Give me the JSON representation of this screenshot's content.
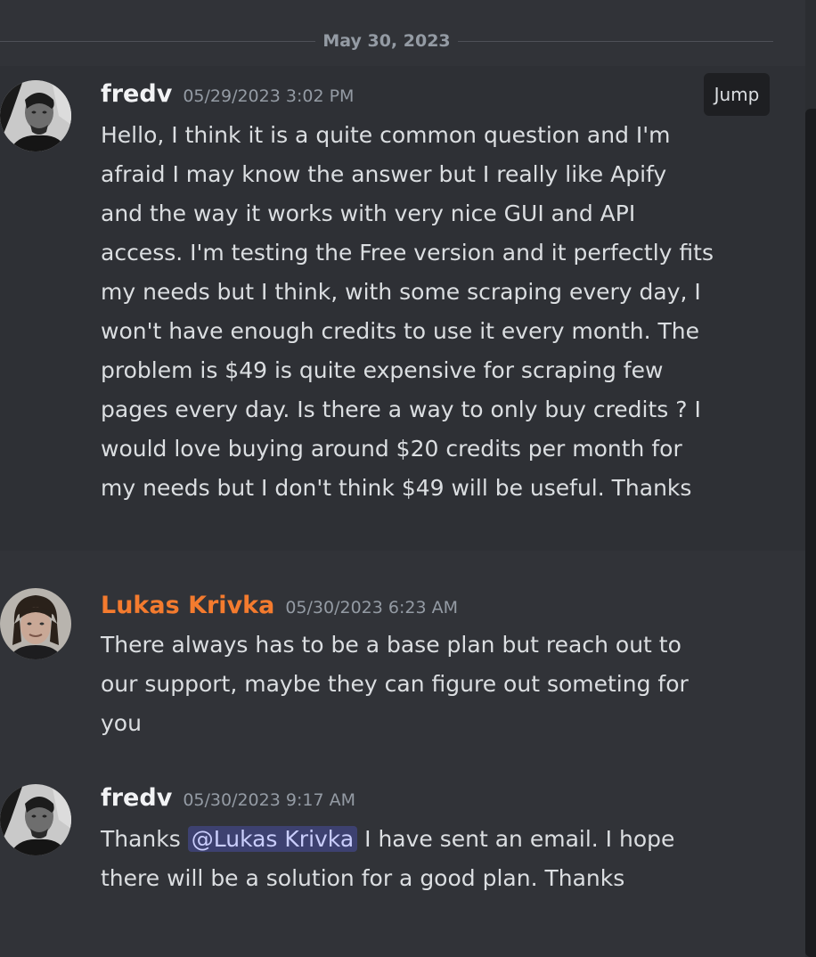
{
  "date_divider": "May 30, 2023",
  "jump_label": "Jump",
  "messages": [
    {
      "username": "fredv",
      "timestamp": "05/29/2023 3:02 PM",
      "content": "Hello, I think it is a quite common question and I'm afraid I may know the answer but I really like Apify and the way it works with very nice GUI and API access. I'm testing the Free version and it perfectly fits my needs but I think, with some scraping every day, I won't have enough credits to use it every month. The problem is $49 is quite expensive for scraping few pages every day.   Is there a way to only buy credits ? I would love buying around $20 credits per month for my needs but I don't think $49 will be useful. Thanks"
    },
    {
      "username": "Lukas Krivka",
      "timestamp": "05/30/2023 6:23 AM",
      "content": "There always has to be a base plan but reach out to our support, maybe they can figure out someting for you"
    },
    {
      "username": "fredv",
      "timestamp": "05/30/2023 9:17 AM",
      "content_before": "Thanks ",
      "mention": "@Lukas Krivka",
      "content_after": "  I have sent an email. I hope there will be a solution for a good plan. Thanks"
    }
  ],
  "colors": {
    "background": "#313338",
    "highlight": "#2e3035",
    "username_default": "#f2f3f5",
    "username_orange": "#f47b2e",
    "mention_bg": "#3c4270",
    "mention_text": "#c9cdfb"
  }
}
